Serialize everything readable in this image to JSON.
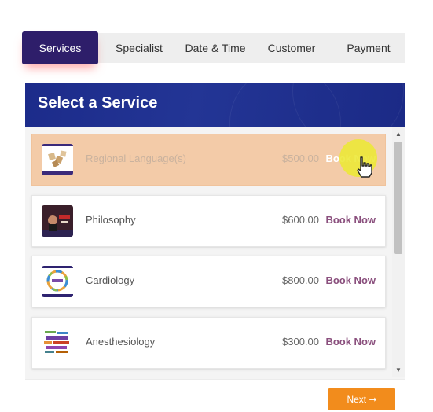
{
  "tabs": [
    {
      "label": "Services",
      "active": true
    },
    {
      "label": "Specialist",
      "active": false
    },
    {
      "label": "Date & Time",
      "active": false
    },
    {
      "label": "Customer",
      "active": false
    },
    {
      "label": "Payment",
      "active": false
    }
  ],
  "panel": {
    "title": "Select a Service"
  },
  "services": [
    {
      "name": "Regional Language(s)",
      "price": "$500.00",
      "action": "Book Now",
      "highlighted": true
    },
    {
      "name": "Philosophy",
      "price": "$600.00",
      "action": "Book Now",
      "highlighted": false
    },
    {
      "name": "Cardiology",
      "price": "$800.00",
      "action": "Book Now",
      "highlighted": false
    },
    {
      "name": "Anesthesiology",
      "price": "$300.00",
      "action": "Book Now",
      "highlighted": false
    }
  ],
  "footer": {
    "next_label": "Next",
    "next_icon": "arrow-right-icon"
  },
  "colors": {
    "tab_active": "#2e1e6a",
    "header": "#1f2f8f",
    "highlight_row": "#f3cba8",
    "book_link": "#8a4f7d",
    "next_button": "#f28c1c"
  }
}
